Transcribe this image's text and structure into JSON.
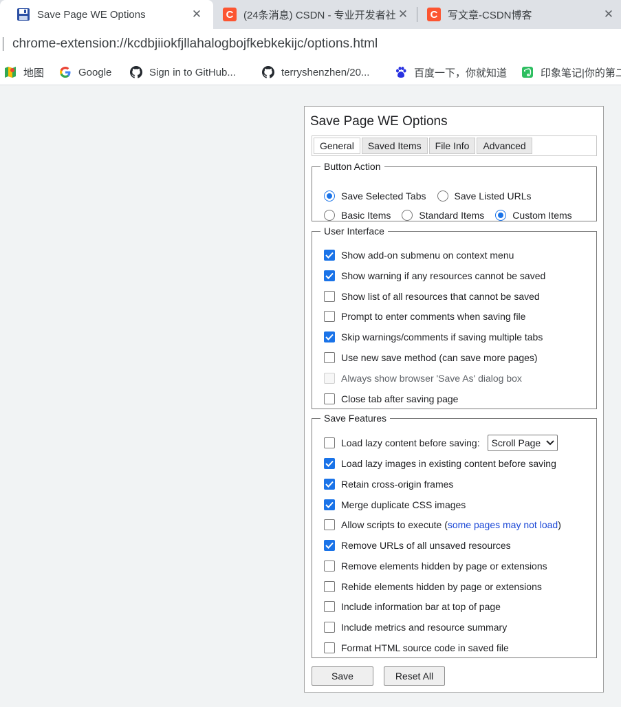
{
  "browser": {
    "tabs": [
      {
        "title": "Save Page WE Options",
        "active": true
      },
      {
        "title": "(24条消息) CSDN - 专业开发者社",
        "active": false
      },
      {
        "title": "写文章-CSDN博客",
        "active": false
      }
    ],
    "url": "chrome-extension://kcdbjiiokfjllahalogbojfkebkekijc/options.html",
    "bookmarks": [
      {
        "label": "地图",
        "icon": "maps-icon"
      },
      {
        "label": "Google",
        "icon": "google-icon"
      },
      {
        "label": "Sign in to GitHub...",
        "icon": "github-icon"
      },
      {
        "label": "terryshenzhen/20...",
        "icon": "github-icon"
      },
      {
        "label": "百度一下，你就知道",
        "icon": "baidu-icon"
      },
      {
        "label": "印象笔记|你的第二",
        "icon": "evernote-icon"
      }
    ],
    "colors": {
      "accent": "#1a73e8",
      "csdn": "#fc5531",
      "link": "#1a47d6"
    }
  },
  "options": {
    "title": "Save Page WE Options",
    "tabs": [
      "General",
      "Saved Items",
      "File Info",
      "Advanced"
    ],
    "button_action": {
      "legend": "Button Action",
      "row1": [
        {
          "label": "Save Selected Tabs",
          "selected": true
        },
        {
          "label": "Save Listed URLs",
          "selected": false
        }
      ],
      "row2": [
        {
          "label": "Basic Items",
          "selected": false
        },
        {
          "label": "Standard Items",
          "selected": false
        },
        {
          "label": "Custom Items",
          "selected": true
        }
      ]
    },
    "user_interface": {
      "legend": "User Interface",
      "items": [
        {
          "label": "Show add-on submenu on context menu",
          "checked": true
        },
        {
          "label": "Show warning if any resources cannot be saved",
          "checked": true
        },
        {
          "label": "Show list of all resources that cannot be saved",
          "checked": false
        },
        {
          "label": "Prompt to enter comments when saving file",
          "checked": false
        },
        {
          "label": "Skip warnings/comments if saving multiple tabs",
          "checked": true
        },
        {
          "label": "Use new save method (can save more pages)",
          "checked": false
        },
        {
          "label": "Always show browser 'Save As' dialog box",
          "checked": false,
          "disabled": true
        },
        {
          "label": "Close tab after saving page",
          "checked": false
        }
      ]
    },
    "save_features": {
      "legend": "Save Features",
      "lazy_content": {
        "label": "Load lazy content before saving:",
        "checked": false,
        "select_value": "Scroll Page"
      },
      "items": [
        {
          "label": "Load lazy images in existing content before saving",
          "checked": true
        },
        {
          "label": "Retain cross-origin frames",
          "checked": true
        },
        {
          "label": "Merge duplicate CSS images",
          "checked": true
        }
      ],
      "scripts": {
        "label": "Allow scripts to execute",
        "note_open": "(",
        "note": "some pages may not load",
        "note_close": ")",
        "checked": false
      },
      "items2": [
        {
          "label": "Remove URLs of all unsaved resources",
          "checked": true
        },
        {
          "label": "Remove elements hidden by page or extensions",
          "checked": false
        },
        {
          "label": "Rehide elements hidden by page or extensions",
          "checked": false
        },
        {
          "label": "Include information bar at top of page",
          "checked": false
        },
        {
          "label": "Include metrics and resource summary",
          "checked": false
        },
        {
          "label": "Format HTML source code in saved file",
          "checked": false
        }
      ]
    },
    "buttons": {
      "save": "Save",
      "reset": "Reset All"
    }
  }
}
